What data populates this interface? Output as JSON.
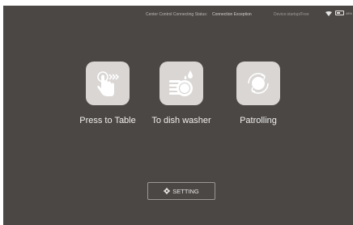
{
  "status_bar": {
    "label": "Center Control Connecting Status:",
    "value": "Connection Exception",
    "device_status": "Device:startup/Free",
    "battery_text": "48%"
  },
  "tiles": [
    {
      "label": "Press to Table",
      "icon": "hand-tap-icon"
    },
    {
      "label": "To dish washer",
      "icon": "dish-washer-icon"
    },
    {
      "label": "Patrolling",
      "icon": "patrol-icon"
    }
  ],
  "setting": {
    "label": "SETTING",
    "icon": "gear-icon"
  },
  "colors": {
    "background": "#4a4745",
    "tile": "#d9d6d4",
    "icon": "#ffffff",
    "text": "#f2f0ee"
  }
}
